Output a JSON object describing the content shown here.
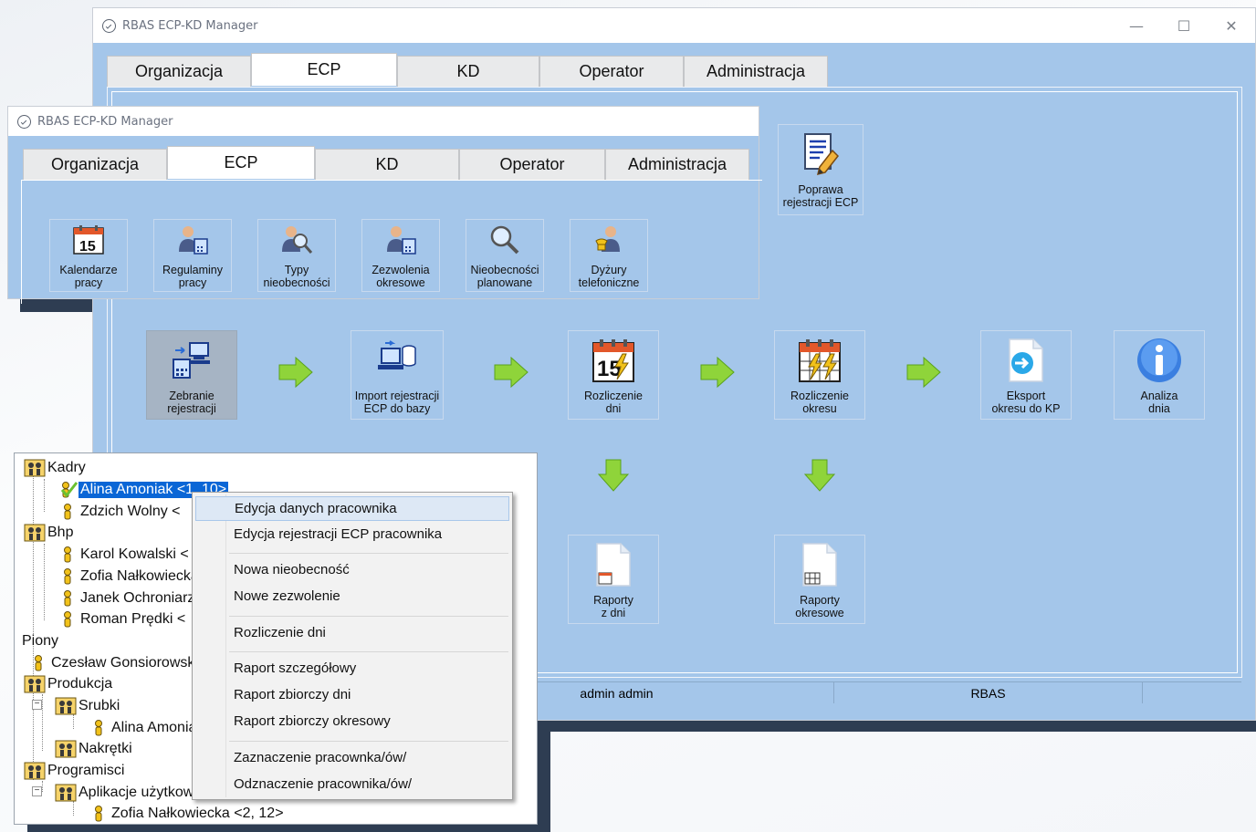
{
  "app_title": "RBAS ECP-KD Manager",
  "window_controls": {
    "minimize": "—",
    "maximize": "☐",
    "close": "✕"
  },
  "tabs": [
    "Organizacja",
    "ECP",
    "KD",
    "Operator",
    "Administracja"
  ],
  "active_tab": "ECP",
  "main_panel": {
    "correction_tile": "Poprawa\nrejestracji ECP",
    "workflow": [
      "Zebranie\nrejestracji",
      "Import rejestracji\nECP do bazy",
      "Rozliczenie\ndni",
      "Rozliczenie\nokresu",
      "Eksport\nokresu do KP",
      "Analiza\ndnia"
    ],
    "reports": [
      "Raporty\nz dni",
      "Raporty\nokresowe"
    ],
    "calendar_day": "15"
  },
  "status_bar": {
    "user": "admin admin",
    "company": "RBAS"
  },
  "ecp_window": {
    "tiles": [
      "Kalendarze\npracy",
      "Regulaminy\npracy",
      "Typy\nnieobecności",
      "Zezwolenia\nokresowe",
      "Nieobecności\nplanowane",
      "Dyżury\ntelefoniczne"
    ],
    "calendar_day": "15"
  },
  "tree": {
    "nodes": [
      {
        "label": "Kadry",
        "type": "group"
      },
      {
        "label": "Alina Amoniak <1, 10>",
        "type": "person-checked"
      },
      {
        "label": "Zdzich Wolny <",
        "type": "person"
      },
      {
        "label": "Bhp",
        "type": "group"
      },
      {
        "label": "Karol Kowalski <",
        "type": "person"
      },
      {
        "label": "Zofia Nałkowiecka",
        "type": "person"
      },
      {
        "label": "Janek Ochroniarz",
        "type": "person"
      },
      {
        "label": "Roman Prędki <",
        "type": "person"
      },
      {
        "label": "Piony",
        "type": "plain"
      },
      {
        "label": "Czesław Gonsiorowski",
        "type": "person"
      },
      {
        "label": "Produkcja",
        "type": "group"
      },
      {
        "label": "Srubki",
        "type": "group"
      },
      {
        "label": "Alina Amoniak",
        "type": "person"
      },
      {
        "label": "Nakrętki",
        "type": "group"
      },
      {
        "label": "Programisci",
        "type": "group"
      },
      {
        "label": "Aplikacje użytkowe",
        "type": "group"
      },
      {
        "label": "Zofia Nałkowiecka <2, 12>",
        "type": "person"
      }
    ]
  },
  "context_menu": {
    "items": [
      "Edycja danych pracownika",
      "Edycja rejestracji ECP pracownika",
      "Nowa nieobecność",
      "Nowe zezwolenie",
      "Rozliczenie dni",
      "Raport szczegółowy",
      "Raport zbiorczy dni",
      "Raport zbiorczy okresowy",
      "Zaznaczenie pracownka/ów/",
      "Odznaczenie pracownika/ów/"
    ]
  }
}
